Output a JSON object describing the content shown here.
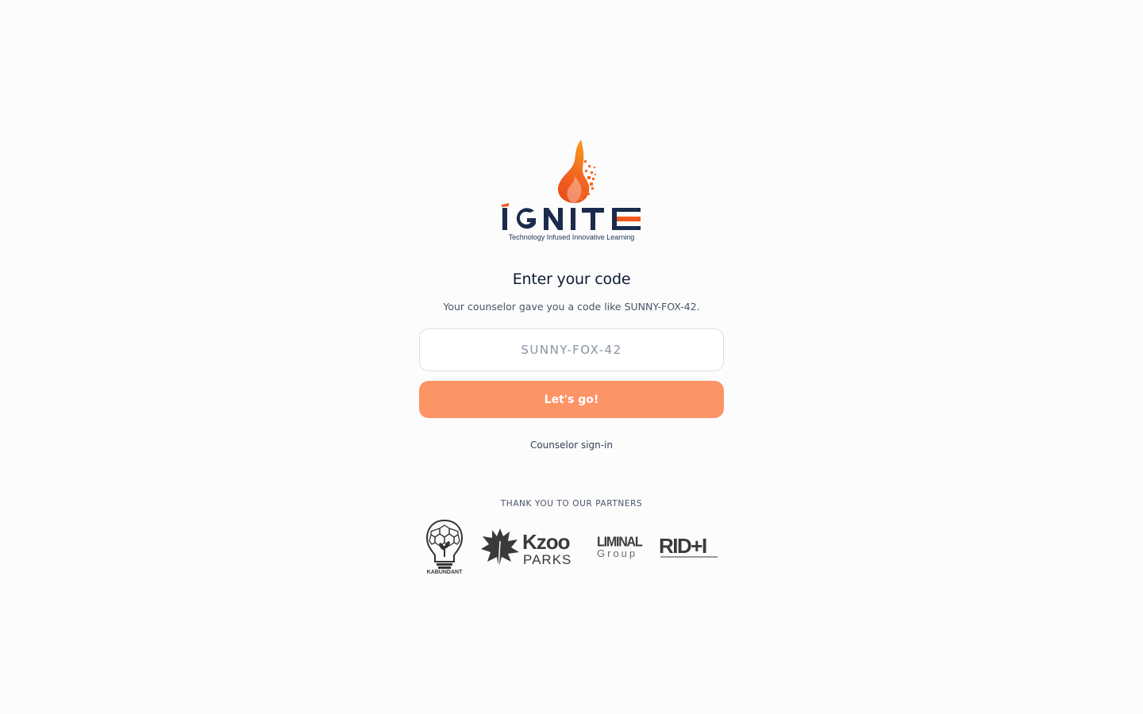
{
  "brand": {
    "name": "IGNITE",
    "tagline": "Technology Infused Innovative Learning"
  },
  "login": {
    "title": "Enter your code",
    "subtitle": "Your counselor gave you a code like SUNNY-FOX-42.",
    "code_placeholder": "SUNNY-FOX-42",
    "code_value": "",
    "submit_label": "Let's go!",
    "counselor_link": "Counselor sign-in"
  },
  "partners": {
    "heading": "THANK YOU TO OUR PARTNERS",
    "items": [
      {
        "name": "KABUNDANT",
        "icon": "lightbulb-icon"
      },
      {
        "name": "Kzoo",
        "sub": "PARKS",
        "icon": "leaf-icon"
      },
      {
        "name": "LIMINAL",
        "sub": "Group"
      },
      {
        "name": "RID+I"
      }
    ]
  },
  "colors": {
    "background": "#fcfcfd",
    "button": "#fd9466",
    "brand_navy": "#1f3559",
    "flame_orange": "#f05a1a"
  }
}
